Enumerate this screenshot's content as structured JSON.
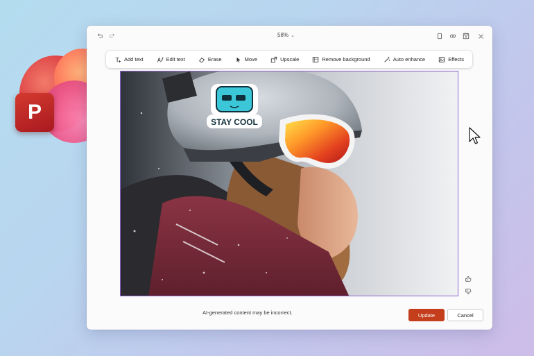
{
  "logo": {
    "letter": "P"
  },
  "window": {
    "zoom_label": "58%",
    "toolbar": {
      "items": [
        {
          "label": "Add text",
          "icon": "add-text-icon"
        },
        {
          "label": "Edit text",
          "icon": "edit-text-icon"
        },
        {
          "label": "Erase",
          "icon": "eraser-icon"
        },
        {
          "label": "Move",
          "icon": "move-icon"
        },
        {
          "label": "Upscale",
          "icon": "upscale-icon"
        },
        {
          "label": "Remove background",
          "icon": "remove-background-icon"
        },
        {
          "label": "Auto enhance",
          "icon": "auto-enhance-icon"
        },
        {
          "label": "Effects",
          "icon": "effects-icon"
        }
      ]
    },
    "image": {
      "sticker_text": "STAY COOL"
    },
    "footer": {
      "disclaimer": "AI-generated content may be incorrect.",
      "update_label": "Update",
      "cancel_label": "Cancel"
    }
  },
  "colors": {
    "accent": "#c43e1c",
    "selection_border": "#8a63c8",
    "logo_red": "#c12a26"
  }
}
